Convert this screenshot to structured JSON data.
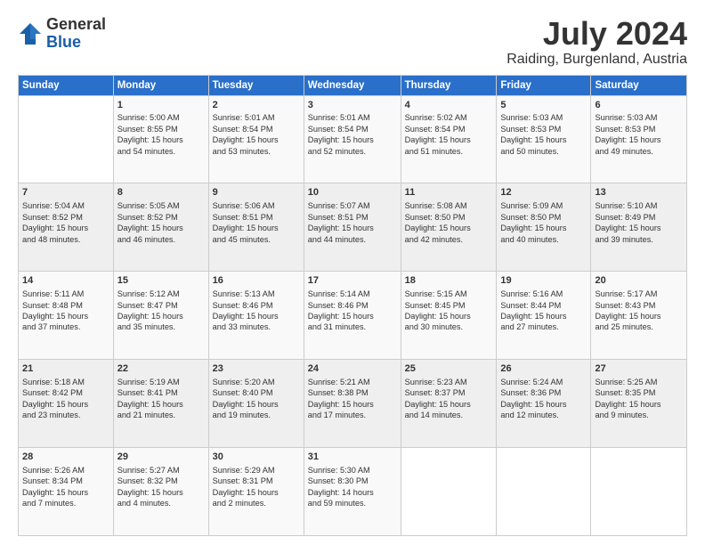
{
  "logo": {
    "general": "General",
    "blue": "Blue"
  },
  "title": "July 2024",
  "location": "Raiding, Burgenland, Austria",
  "days_of_week": [
    "Sunday",
    "Monday",
    "Tuesday",
    "Wednesday",
    "Thursday",
    "Friday",
    "Saturday"
  ],
  "weeks": [
    [
      {
        "day": "",
        "content": ""
      },
      {
        "day": "1",
        "content": "Sunrise: 5:00 AM\nSunset: 8:55 PM\nDaylight: 15 hours\nand 54 minutes."
      },
      {
        "day": "2",
        "content": "Sunrise: 5:01 AM\nSunset: 8:54 PM\nDaylight: 15 hours\nand 53 minutes."
      },
      {
        "day": "3",
        "content": "Sunrise: 5:01 AM\nSunset: 8:54 PM\nDaylight: 15 hours\nand 52 minutes."
      },
      {
        "day": "4",
        "content": "Sunrise: 5:02 AM\nSunset: 8:54 PM\nDaylight: 15 hours\nand 51 minutes."
      },
      {
        "day": "5",
        "content": "Sunrise: 5:03 AM\nSunset: 8:53 PM\nDaylight: 15 hours\nand 50 minutes."
      },
      {
        "day": "6",
        "content": "Sunrise: 5:03 AM\nSunset: 8:53 PM\nDaylight: 15 hours\nand 49 minutes."
      }
    ],
    [
      {
        "day": "7",
        "content": "Sunrise: 5:04 AM\nSunset: 8:52 PM\nDaylight: 15 hours\nand 48 minutes."
      },
      {
        "day": "8",
        "content": "Sunrise: 5:05 AM\nSunset: 8:52 PM\nDaylight: 15 hours\nand 46 minutes."
      },
      {
        "day": "9",
        "content": "Sunrise: 5:06 AM\nSunset: 8:51 PM\nDaylight: 15 hours\nand 45 minutes."
      },
      {
        "day": "10",
        "content": "Sunrise: 5:07 AM\nSunset: 8:51 PM\nDaylight: 15 hours\nand 44 minutes."
      },
      {
        "day": "11",
        "content": "Sunrise: 5:08 AM\nSunset: 8:50 PM\nDaylight: 15 hours\nand 42 minutes."
      },
      {
        "day": "12",
        "content": "Sunrise: 5:09 AM\nSunset: 8:50 PM\nDaylight: 15 hours\nand 40 minutes."
      },
      {
        "day": "13",
        "content": "Sunrise: 5:10 AM\nSunset: 8:49 PM\nDaylight: 15 hours\nand 39 minutes."
      }
    ],
    [
      {
        "day": "14",
        "content": "Sunrise: 5:11 AM\nSunset: 8:48 PM\nDaylight: 15 hours\nand 37 minutes."
      },
      {
        "day": "15",
        "content": "Sunrise: 5:12 AM\nSunset: 8:47 PM\nDaylight: 15 hours\nand 35 minutes."
      },
      {
        "day": "16",
        "content": "Sunrise: 5:13 AM\nSunset: 8:46 PM\nDaylight: 15 hours\nand 33 minutes."
      },
      {
        "day": "17",
        "content": "Sunrise: 5:14 AM\nSunset: 8:46 PM\nDaylight: 15 hours\nand 31 minutes."
      },
      {
        "day": "18",
        "content": "Sunrise: 5:15 AM\nSunset: 8:45 PM\nDaylight: 15 hours\nand 30 minutes."
      },
      {
        "day": "19",
        "content": "Sunrise: 5:16 AM\nSunset: 8:44 PM\nDaylight: 15 hours\nand 27 minutes."
      },
      {
        "day": "20",
        "content": "Sunrise: 5:17 AM\nSunset: 8:43 PM\nDaylight: 15 hours\nand 25 minutes."
      }
    ],
    [
      {
        "day": "21",
        "content": "Sunrise: 5:18 AM\nSunset: 8:42 PM\nDaylight: 15 hours\nand 23 minutes."
      },
      {
        "day": "22",
        "content": "Sunrise: 5:19 AM\nSunset: 8:41 PM\nDaylight: 15 hours\nand 21 minutes."
      },
      {
        "day": "23",
        "content": "Sunrise: 5:20 AM\nSunset: 8:40 PM\nDaylight: 15 hours\nand 19 minutes."
      },
      {
        "day": "24",
        "content": "Sunrise: 5:21 AM\nSunset: 8:38 PM\nDaylight: 15 hours\nand 17 minutes."
      },
      {
        "day": "25",
        "content": "Sunrise: 5:23 AM\nSunset: 8:37 PM\nDaylight: 15 hours\nand 14 minutes."
      },
      {
        "day": "26",
        "content": "Sunrise: 5:24 AM\nSunset: 8:36 PM\nDaylight: 15 hours\nand 12 minutes."
      },
      {
        "day": "27",
        "content": "Sunrise: 5:25 AM\nSunset: 8:35 PM\nDaylight: 15 hours\nand 9 minutes."
      }
    ],
    [
      {
        "day": "28",
        "content": "Sunrise: 5:26 AM\nSunset: 8:34 PM\nDaylight: 15 hours\nand 7 minutes."
      },
      {
        "day": "29",
        "content": "Sunrise: 5:27 AM\nSunset: 8:32 PM\nDaylight: 15 hours\nand 4 minutes."
      },
      {
        "day": "30",
        "content": "Sunrise: 5:29 AM\nSunset: 8:31 PM\nDaylight: 15 hours\nand 2 minutes."
      },
      {
        "day": "31",
        "content": "Sunrise: 5:30 AM\nSunset: 8:30 PM\nDaylight: 14 hours\nand 59 minutes."
      },
      {
        "day": "",
        "content": ""
      },
      {
        "day": "",
        "content": ""
      },
      {
        "day": "",
        "content": ""
      }
    ]
  ]
}
